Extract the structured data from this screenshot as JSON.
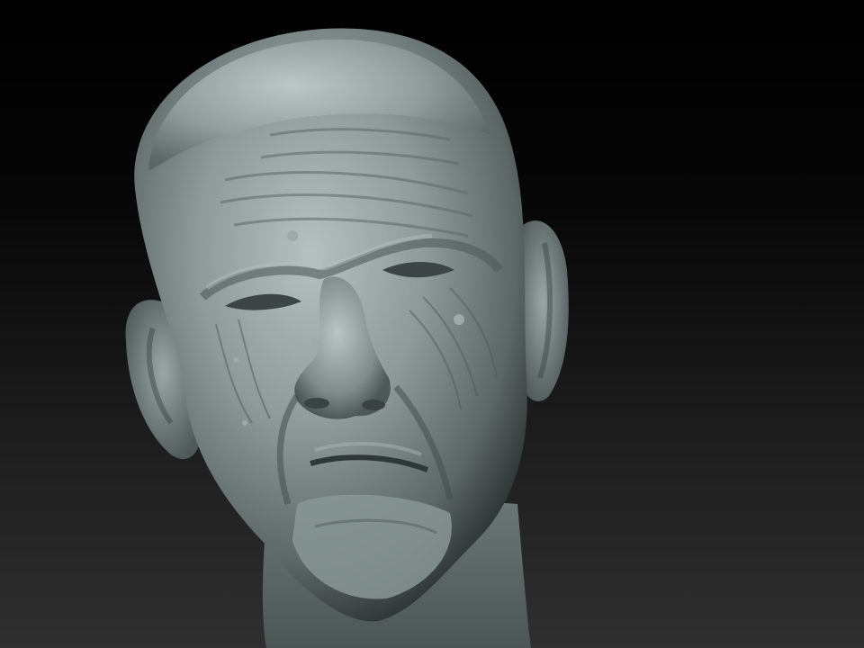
{
  "viewport": {
    "background_top": "#000000",
    "background_bottom": "#2f2f2f"
  },
  "model": {
    "subject": "sculpted-elderly-head",
    "material_base": "#7f8c8c",
    "material_highlight": "#b8c4c3",
    "material_shadow": "#2b3232"
  }
}
